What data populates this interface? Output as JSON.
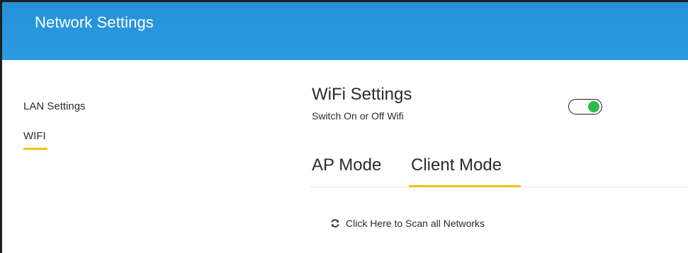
{
  "header": {
    "title": "Network Settings"
  },
  "sidebar": {
    "items": [
      {
        "label": "LAN Settings"
      },
      {
        "label": "WIFI",
        "active": true
      }
    ]
  },
  "wifi": {
    "title": "WiFi Settings",
    "subtitle": "Switch On or Off Wifi",
    "enabled": true,
    "toggle_color": "#2db84c"
  },
  "tabs": [
    {
      "label": "AP Mode",
      "active": false
    },
    {
      "label": "Client Mode",
      "active": true
    }
  ],
  "scan": {
    "icon": "refresh-icon",
    "label": "Click Here to Scan all Networks"
  },
  "colors": {
    "header": "#2a9ae3",
    "accent": "#f1c40f"
  }
}
